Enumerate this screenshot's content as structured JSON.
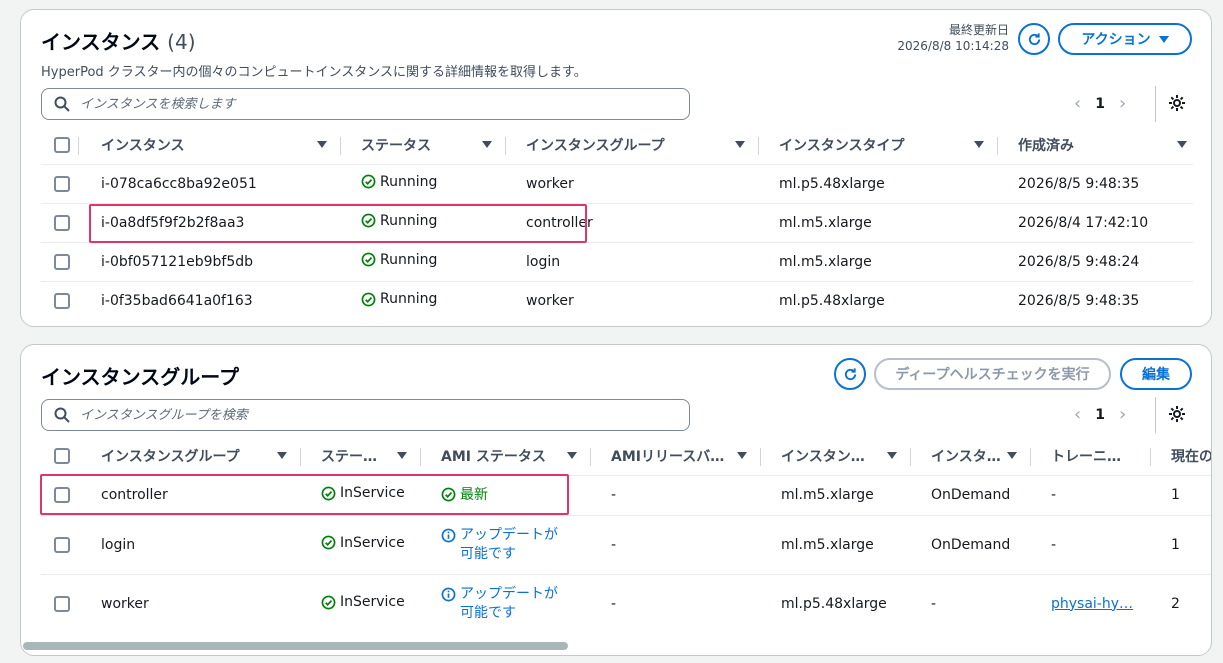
{
  "instances": {
    "title": "インスタンス",
    "count": "(4)",
    "description": "HyperPod クラスター内の個々のコンピュートインスタンスに関する詳細情報を取得します。",
    "last_updated_label": "最終更新日",
    "last_updated_value": "2026/8/8 10:14:28",
    "action_label": "アクション",
    "search_placeholder": "インスタンスを検索します",
    "page": "1",
    "columns": [
      "インスタンス",
      "ステータス",
      "インスタンスグループ",
      "インスタンスタイプ",
      "作成済み"
    ],
    "rows": [
      {
        "id": "i-078ca6cc8ba92e051",
        "status": "Running",
        "group": "worker",
        "type": "ml.p5.48xlarge",
        "created": "2026/8/5 9:48:35"
      },
      {
        "id": "i-0a8df5f9f2b2f8aa3",
        "status": "Running",
        "group": "controller",
        "type": "ml.m5.xlarge",
        "created": "2026/8/4 17:42:10"
      },
      {
        "id": "i-0bf057121eb9bf5db",
        "status": "Running",
        "group": "login",
        "type": "ml.m5.xlarge",
        "created": "2026/8/5 9:48:24"
      },
      {
        "id": "i-0f35bad6641a0f163",
        "status": "Running",
        "group": "worker",
        "type": "ml.p5.48xlarge",
        "created": "2026/8/5 9:48:35"
      }
    ]
  },
  "groups": {
    "title": "インスタンスグループ",
    "deep_health_label": "ディープヘルスチェックを実行",
    "edit_label": "編集",
    "search_placeholder": "インスタンスグループを検索",
    "page": "1",
    "columns": [
      "インスタンスグループ",
      "ステー…",
      "AMI ステータス",
      "AMIリリースバ…",
      "インスタン…",
      "インスタ…",
      "トレーニ…",
      "現在の数"
    ],
    "rows": [
      {
        "name": "controller",
        "status": "InService",
        "ami_status": "最新",
        "ami_kind": "latest",
        "ami_release": "-",
        "type": "ml.m5.xlarge",
        "market": "OnDemand",
        "training": "-",
        "count": "1"
      },
      {
        "name": "login",
        "status": "InService",
        "ami_status_line1": "アップデートが",
        "ami_status_line2": "可能です",
        "ami_kind": "update",
        "ami_release": "-",
        "type": "ml.m5.xlarge",
        "market": "OnDemand",
        "training": "-",
        "count": "1"
      },
      {
        "name": "worker",
        "status": "InService",
        "ami_status_line1": "アップデートが",
        "ami_status_line2": "可能です",
        "ami_kind": "update",
        "ami_release": "-",
        "type": "ml.p5.48xlarge",
        "market": "-",
        "training": "physai-hy…",
        "count": "2"
      }
    ]
  },
  "colors": {
    "primary": "#0972d3",
    "success": "#037f0c",
    "highlight": "#e0356a"
  }
}
